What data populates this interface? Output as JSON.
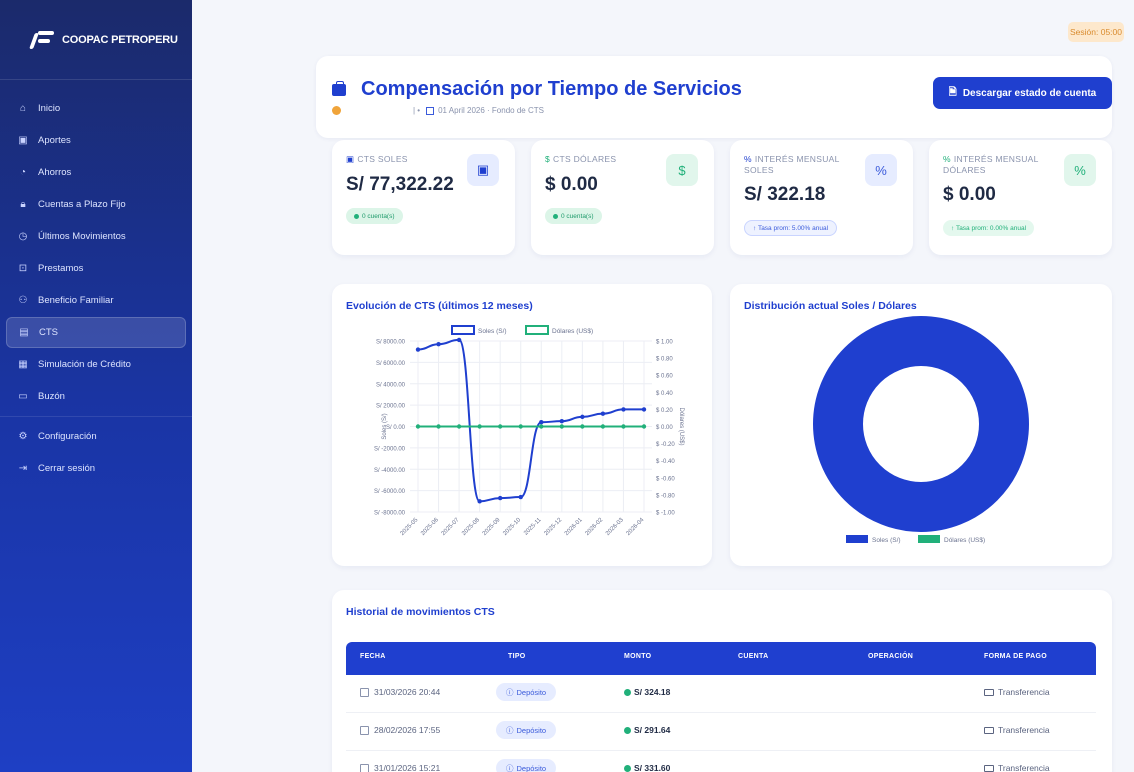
{
  "brand": {
    "name": "COOPAC PETROPERU"
  },
  "sidebar": {
    "items": [
      {
        "label": "Inicio",
        "icon": "home-icon"
      },
      {
        "label": "Aportes",
        "icon": "wallet-icon"
      },
      {
        "label": "Ahorros",
        "icon": "piggy-bank-icon"
      },
      {
        "label": "Cuentas a Plazo Fijo",
        "icon": "lock-icon"
      },
      {
        "label": "Últimos Movimientos",
        "icon": "clock-icon"
      },
      {
        "label": "Prestamos",
        "icon": "gift-icon"
      },
      {
        "label": "Beneficio Familiar",
        "icon": "family-icon"
      },
      {
        "label": "CTS",
        "icon": "briefcase-icon"
      },
      {
        "label": "Simulación de Crédito",
        "icon": "calculator-icon"
      },
      {
        "label": "Buzón",
        "icon": "inbox-icon"
      },
      {
        "label": "Configuración",
        "icon": "gear-icon"
      },
      {
        "label": "Cerrar sesión",
        "icon": "logout-icon"
      }
    ],
    "active": "CTS"
  },
  "session": {
    "label": "Sesión: 05:00"
  },
  "header": {
    "title": "Compensación por Tiempo de Servicios",
    "subtitle_sep": "| •",
    "subtitle": "01 April 2026 · Fondo de CTS",
    "download_label": "Descargar estado de cuenta"
  },
  "stats": [
    {
      "label": "CTS SOLES",
      "value": "S/ 77,322.22",
      "badge": "0 cuenta(s)",
      "icon": "wallet-icon"
    },
    {
      "label": "CTS DÓLARES",
      "value": "$ 0.00",
      "badge": "0 cuenta(s)",
      "icon": "dollar-icon"
    },
    {
      "label": "INTERÉS MENSUAL SOLES",
      "value": "S/ 322.18",
      "badge": "↑ Tasa prom: 5.00% anual",
      "icon": "percent-icon"
    },
    {
      "label": "INTERÉS MENSUAL DÓLARES",
      "value": "$ 0.00",
      "badge": "↑ Tasa prom: 0.00% anual",
      "icon": "percent-icon"
    }
  ],
  "colors": {
    "primary": "#1f3fcf",
    "green": "#21b07a",
    "sidebar": "#1a35a6"
  },
  "line_chart_title": "Evolución de CTS (últimos 12 meses)",
  "donut_chart_title": "Distribución actual Soles / Dólares",
  "chart_data": [
    {
      "type": "line",
      "title": "Evolución de CTS (últimos 12 meses)",
      "x": [
        "2025-05",
        "2025-06",
        "2025-07",
        "2025-08",
        "2025-09",
        "2025-10",
        "2025-11",
        "2025-12",
        "2026-01",
        "2026-02",
        "2026-03",
        "2026-04"
      ],
      "series": [
        {
          "name": "Soles (S/)",
          "axis": "left",
          "color": "#1f3fcf",
          "values": [
            7200,
            7700,
            8100,
            -7000,
            -6700,
            -6600,
            400,
            500,
            900,
            1200,
            1600,
            1600
          ]
        },
        {
          "name": "Dólares (US$)",
          "axis": "right",
          "color": "#21b07a",
          "values": [
            0,
            0,
            0,
            0,
            0,
            0,
            0,
            0,
            0,
            0,
            0,
            0
          ]
        }
      ],
      "ylabel": "Soles (S/)",
      "y2label": "Dólares (US$)",
      "ylim": [
        -8000,
        8000
      ],
      "y2lim": [
        -1,
        1
      ],
      "yticks": [
        "S/ 8000.00",
        "S/ 6000.00",
        "S/ 4000.00",
        "S/ 2000.00",
        "S/ 0.00",
        "S/ -2000.00",
        "S/ -4000.00",
        "S/ -6000.00",
        "S/ -8000.00"
      ],
      "y2ticks": [
        "$ 1.00",
        "$ 0.80",
        "$ 0.60",
        "$ 0.40",
        "$ 0.20",
        "$ 0.00",
        "$ -0.20",
        "$ -0.40",
        "$ -0.60",
        "$ -0.80",
        "$ -1.00"
      ],
      "legend": "top",
      "grid": true
    },
    {
      "type": "pie",
      "title": "Distribución actual Soles / Dólares",
      "categories": [
        "Soles (S/)",
        "Dólares (US$)"
      ],
      "values": [
        77322.22,
        0
      ],
      "colors": [
        "#1f3fcf",
        "#21b07a"
      ],
      "legend": "bottom"
    }
  ],
  "table": {
    "title": "Historial de movimientos CTS",
    "headers": [
      "FECHA",
      "TIPO",
      "MONTO",
      "CUENTA",
      "OPERACIÓN",
      "FORMA DE PAGO"
    ],
    "rows": [
      {
        "fecha": "31/03/2026 20:44",
        "tipo": "Depósito",
        "monto": "S/ 324.18",
        "forma": "Transferencia"
      },
      {
        "fecha": "28/02/2026 17:55",
        "tipo": "Depósito",
        "monto": "S/ 291.64",
        "forma": "Transferencia"
      },
      {
        "fecha": "31/01/2026 15:21",
        "tipo": "Depósito",
        "monto": "S/ 331.60",
        "forma": "Transferencia"
      }
    ]
  }
}
